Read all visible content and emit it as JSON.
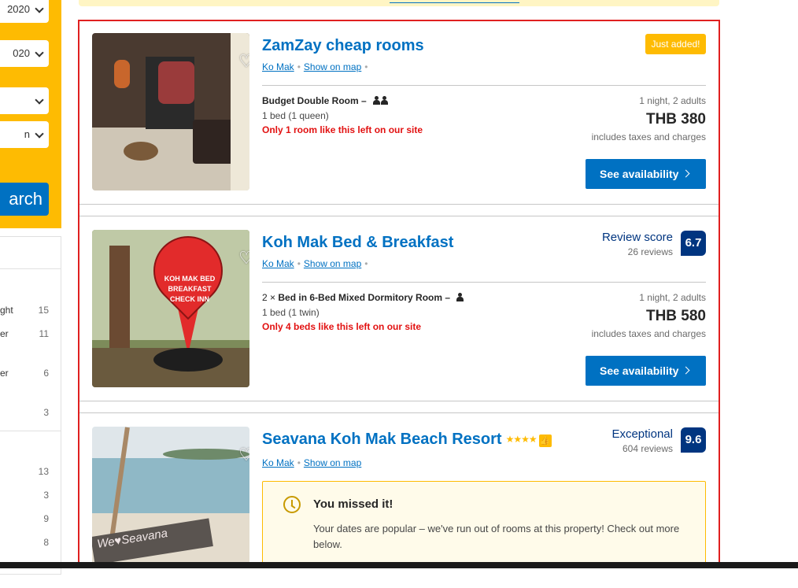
{
  "sidebar": {
    "selects": [
      {
        "value": "2020"
      },
      {
        "value": "020"
      },
      {
        "value": ""
      },
      {
        "value": "n"
      }
    ],
    "search_label": "arch",
    "filters": [
      {
        "label": "ght",
        "count": "15"
      },
      {
        "label": "er",
        "count": "11"
      },
      {
        "label": "er",
        "count": "6"
      },
      {
        "label": "",
        "count": "3"
      },
      {
        "label": "",
        "count": "13"
      },
      {
        "label": "",
        "count": "3"
      },
      {
        "label": "",
        "count": "9"
      },
      {
        "label": "",
        "count": "8"
      }
    ]
  },
  "results": [
    {
      "title": "ZamZay cheap rooms",
      "location": "Ko Mak",
      "map_link": "Show on map",
      "badge": "Just added!",
      "room_name": "Budget Double Room",
      "room_bed": "1 bed (1 queen)",
      "room_left": "Only 1 room like this left on our site",
      "nights": "1 night, 2 adults",
      "price": "THB 380",
      "taxes": "includes taxes and charges",
      "button": "See availability"
    },
    {
      "title": "Koh Mak Bed & Breakfast",
      "location": "Ko Mak",
      "map_link": "Show on map",
      "score_word": "Review score",
      "reviews": "26 reviews",
      "score": "6.7",
      "room_qty": "2 ×",
      "room_name": "Bed in 6-Bed Mixed Dormitory Room",
      "room_bed": "1 bed (1 twin)",
      "room_left": "Only 4 beds like this left on our site",
      "nights": "1 night, 2 adults",
      "price": "THB 580",
      "taxes": "includes taxes and charges",
      "button": "See availability",
      "photo_sign_text": "KOH MAK BED BREAKFAST CHECK INN"
    },
    {
      "title": "Seavana Koh Mak Beach Resort",
      "stars": "★★★★",
      "location": "Ko Mak",
      "map_link": "Show on map",
      "score_word": "Exceptional",
      "reviews": "604 reviews",
      "score": "9.6",
      "missed_title": "You missed it!",
      "missed_text": "Your dates are popular – we've run out of rooms at this property! Check out more below.",
      "photo_sign_text": "We♥Seavana"
    }
  ],
  "icons": {
    "heart": "heart-icon",
    "chevron": "chevron-right-icon",
    "clock": "clock-icon",
    "thumbs_up": "thumbs-up-icon",
    "person": "person-icon"
  },
  "colors": {
    "brand_blue": "#0071c2",
    "dark_blue": "#003580",
    "yellow": "#febb02",
    "alert_red": "#e21111",
    "highlight_border": "#e02020"
  }
}
